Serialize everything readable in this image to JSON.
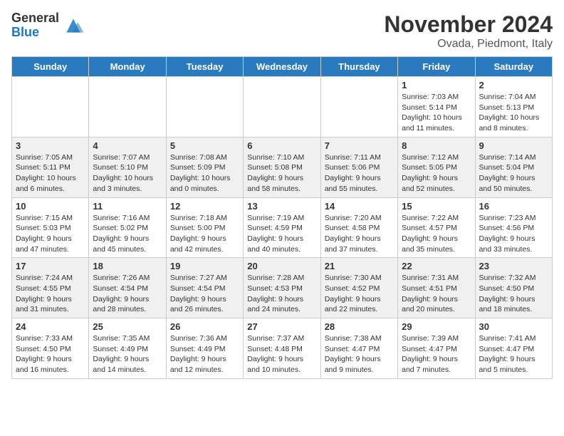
{
  "header": {
    "logo_general": "General",
    "logo_blue": "Blue",
    "month_title": "November 2024",
    "location": "Ovada, Piedmont, Italy"
  },
  "weekdays": [
    "Sunday",
    "Monday",
    "Tuesday",
    "Wednesday",
    "Thursday",
    "Friday",
    "Saturday"
  ],
  "weeks": [
    [
      {
        "day": "",
        "info": ""
      },
      {
        "day": "",
        "info": ""
      },
      {
        "day": "",
        "info": ""
      },
      {
        "day": "",
        "info": ""
      },
      {
        "day": "",
        "info": ""
      },
      {
        "day": "1",
        "info": "Sunrise: 7:03 AM\nSunset: 5:14 PM\nDaylight: 10 hours\nand 11 minutes."
      },
      {
        "day": "2",
        "info": "Sunrise: 7:04 AM\nSunset: 5:13 PM\nDaylight: 10 hours\nand 8 minutes."
      }
    ],
    [
      {
        "day": "3",
        "info": "Sunrise: 7:05 AM\nSunset: 5:11 PM\nDaylight: 10 hours\nand 6 minutes."
      },
      {
        "day": "4",
        "info": "Sunrise: 7:07 AM\nSunset: 5:10 PM\nDaylight: 10 hours\nand 3 minutes."
      },
      {
        "day": "5",
        "info": "Sunrise: 7:08 AM\nSunset: 5:09 PM\nDaylight: 10 hours\nand 0 minutes."
      },
      {
        "day": "6",
        "info": "Sunrise: 7:10 AM\nSunset: 5:08 PM\nDaylight: 9 hours\nand 58 minutes."
      },
      {
        "day": "7",
        "info": "Sunrise: 7:11 AM\nSunset: 5:06 PM\nDaylight: 9 hours\nand 55 minutes."
      },
      {
        "day": "8",
        "info": "Sunrise: 7:12 AM\nSunset: 5:05 PM\nDaylight: 9 hours\nand 52 minutes."
      },
      {
        "day": "9",
        "info": "Sunrise: 7:14 AM\nSunset: 5:04 PM\nDaylight: 9 hours\nand 50 minutes."
      }
    ],
    [
      {
        "day": "10",
        "info": "Sunrise: 7:15 AM\nSunset: 5:03 PM\nDaylight: 9 hours\nand 47 minutes."
      },
      {
        "day": "11",
        "info": "Sunrise: 7:16 AM\nSunset: 5:02 PM\nDaylight: 9 hours\nand 45 minutes."
      },
      {
        "day": "12",
        "info": "Sunrise: 7:18 AM\nSunset: 5:00 PM\nDaylight: 9 hours\nand 42 minutes."
      },
      {
        "day": "13",
        "info": "Sunrise: 7:19 AM\nSunset: 4:59 PM\nDaylight: 9 hours\nand 40 minutes."
      },
      {
        "day": "14",
        "info": "Sunrise: 7:20 AM\nSunset: 4:58 PM\nDaylight: 9 hours\nand 37 minutes."
      },
      {
        "day": "15",
        "info": "Sunrise: 7:22 AM\nSunset: 4:57 PM\nDaylight: 9 hours\nand 35 minutes."
      },
      {
        "day": "16",
        "info": "Sunrise: 7:23 AM\nSunset: 4:56 PM\nDaylight: 9 hours\nand 33 minutes."
      }
    ],
    [
      {
        "day": "17",
        "info": "Sunrise: 7:24 AM\nSunset: 4:55 PM\nDaylight: 9 hours\nand 31 minutes."
      },
      {
        "day": "18",
        "info": "Sunrise: 7:26 AM\nSunset: 4:54 PM\nDaylight: 9 hours\nand 28 minutes."
      },
      {
        "day": "19",
        "info": "Sunrise: 7:27 AM\nSunset: 4:54 PM\nDaylight: 9 hours\nand 26 minutes."
      },
      {
        "day": "20",
        "info": "Sunrise: 7:28 AM\nSunset: 4:53 PM\nDaylight: 9 hours\nand 24 minutes."
      },
      {
        "day": "21",
        "info": "Sunrise: 7:30 AM\nSunset: 4:52 PM\nDaylight: 9 hours\nand 22 minutes."
      },
      {
        "day": "22",
        "info": "Sunrise: 7:31 AM\nSunset: 4:51 PM\nDaylight: 9 hours\nand 20 minutes."
      },
      {
        "day": "23",
        "info": "Sunrise: 7:32 AM\nSunset: 4:50 PM\nDaylight: 9 hours\nand 18 minutes."
      }
    ],
    [
      {
        "day": "24",
        "info": "Sunrise: 7:33 AM\nSunset: 4:50 PM\nDaylight: 9 hours\nand 16 minutes."
      },
      {
        "day": "25",
        "info": "Sunrise: 7:35 AM\nSunset: 4:49 PM\nDaylight: 9 hours\nand 14 minutes."
      },
      {
        "day": "26",
        "info": "Sunrise: 7:36 AM\nSunset: 4:49 PM\nDaylight: 9 hours\nand 12 minutes."
      },
      {
        "day": "27",
        "info": "Sunrise: 7:37 AM\nSunset: 4:48 PM\nDaylight: 9 hours\nand 10 minutes."
      },
      {
        "day": "28",
        "info": "Sunrise: 7:38 AM\nSunset: 4:47 PM\nDaylight: 9 hours\nand 9 minutes."
      },
      {
        "day": "29",
        "info": "Sunrise: 7:39 AM\nSunset: 4:47 PM\nDaylight: 9 hours\nand 7 minutes."
      },
      {
        "day": "30",
        "info": "Sunrise: 7:41 AM\nSunset: 4:47 PM\nDaylight: 9 hours\nand 5 minutes."
      }
    ]
  ]
}
